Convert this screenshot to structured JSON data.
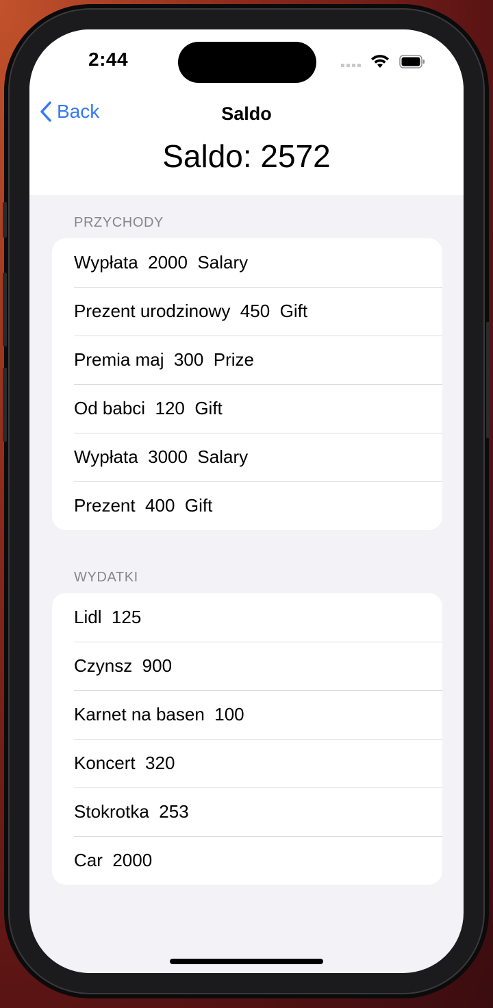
{
  "status_bar": {
    "time": "2:44"
  },
  "nav": {
    "back_label": "Back",
    "title": "Saldo"
  },
  "balance_title": "Saldo: 2572",
  "income": {
    "header": "PRZYCHODY",
    "items": [
      {
        "text": "Wypłata  2000  Salary"
      },
      {
        "text": "Prezent urodzinowy  450  Gift"
      },
      {
        "text": "Premia maj  300  Prize"
      },
      {
        "text": "Od babci  120  Gift"
      },
      {
        "text": "Wypłata  3000  Salary"
      },
      {
        "text": "Prezent  400  Gift"
      }
    ]
  },
  "expenses": {
    "header": "WYDATKI",
    "items": [
      {
        "text": "Lidl  125"
      },
      {
        "text": "Czynsz  900"
      },
      {
        "text": "Karnet na basen  100"
      },
      {
        "text": "Koncert  320"
      },
      {
        "text": "Stokrotka  253"
      },
      {
        "text": "Car  2000"
      }
    ]
  },
  "colors": {
    "accent": "#3478f6",
    "grouped_background": "#f2f2f7",
    "card_background": "#ffffff",
    "section_header": "#86868b"
  },
  "icons": {
    "back": "chevron-left-icon",
    "wifi": "wifi-icon",
    "battery": "battery-icon",
    "signal": "cellular-signal-icon"
  }
}
